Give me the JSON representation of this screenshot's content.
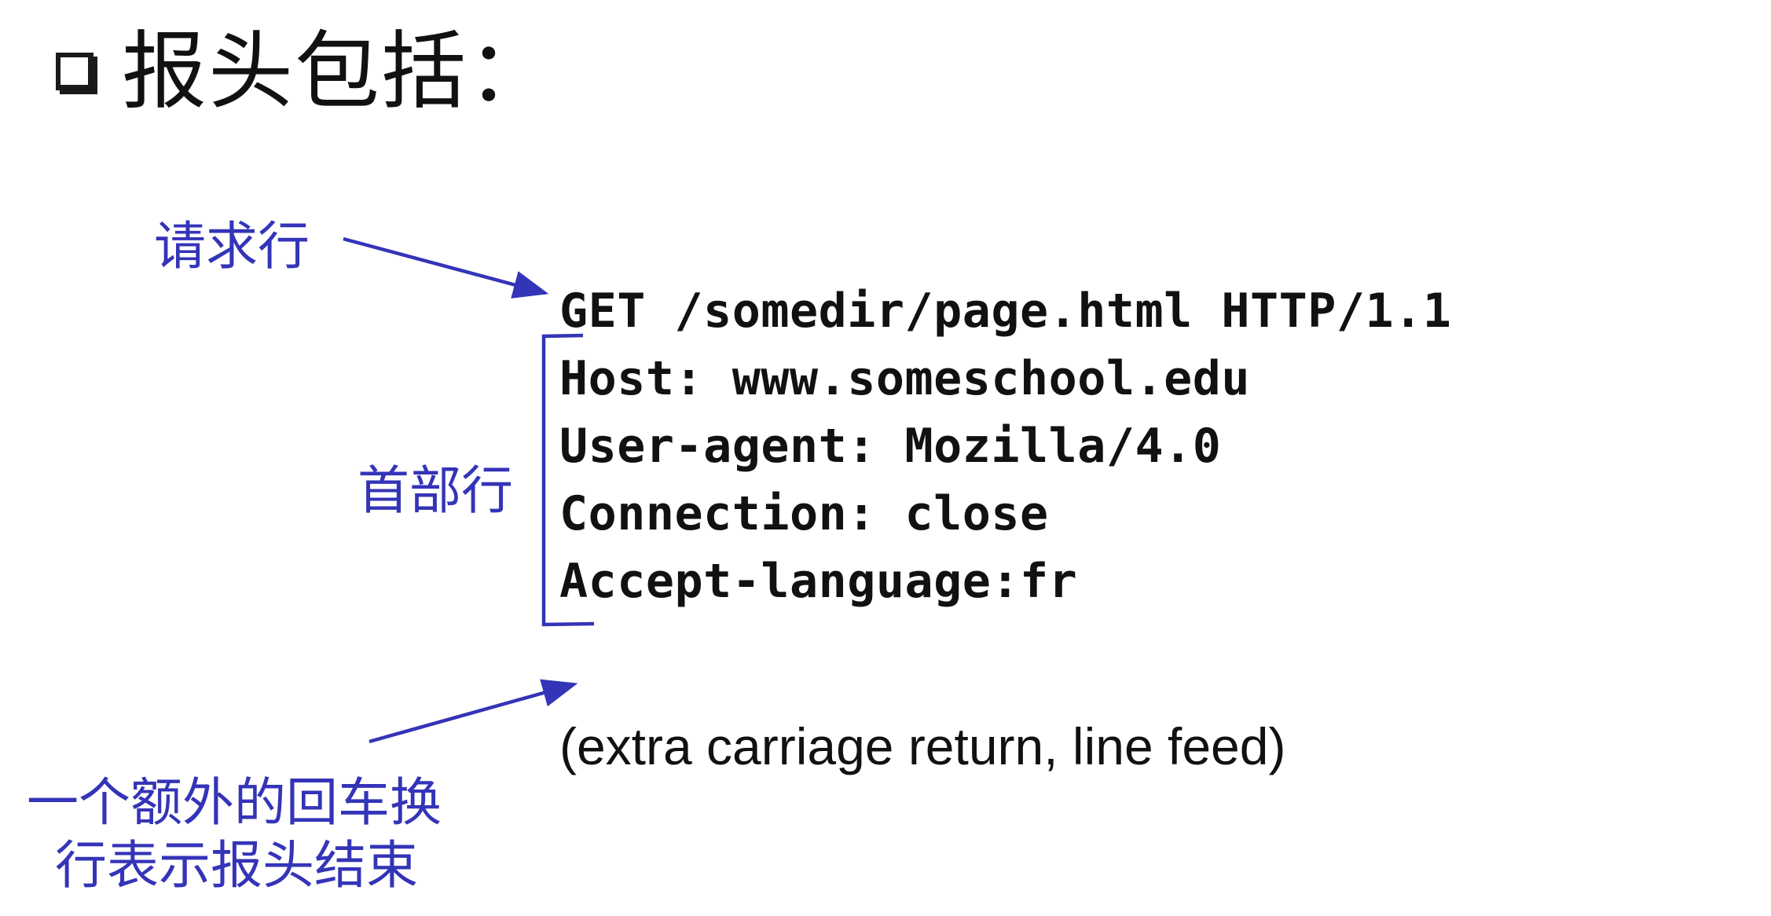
{
  "heading": {
    "text": "报头包括："
  },
  "labels": {
    "request_line": "请求行",
    "header_lines": "首部行",
    "end_note_line1": "一个额外的回车换",
    "end_note_line2": "行表示报头结束"
  },
  "request": {
    "lines": [
      "GET /somedir/page.html HTTP/1.1",
      "Host: www.someschool.edu",
      "User-agent: Mozilla/4.0",
      "Connection: close",
      "Accept-language:fr"
    ]
  },
  "note": "(extra carriage return, line feed)",
  "colors": {
    "annotation": "#3434b8",
    "text": "#111111"
  }
}
